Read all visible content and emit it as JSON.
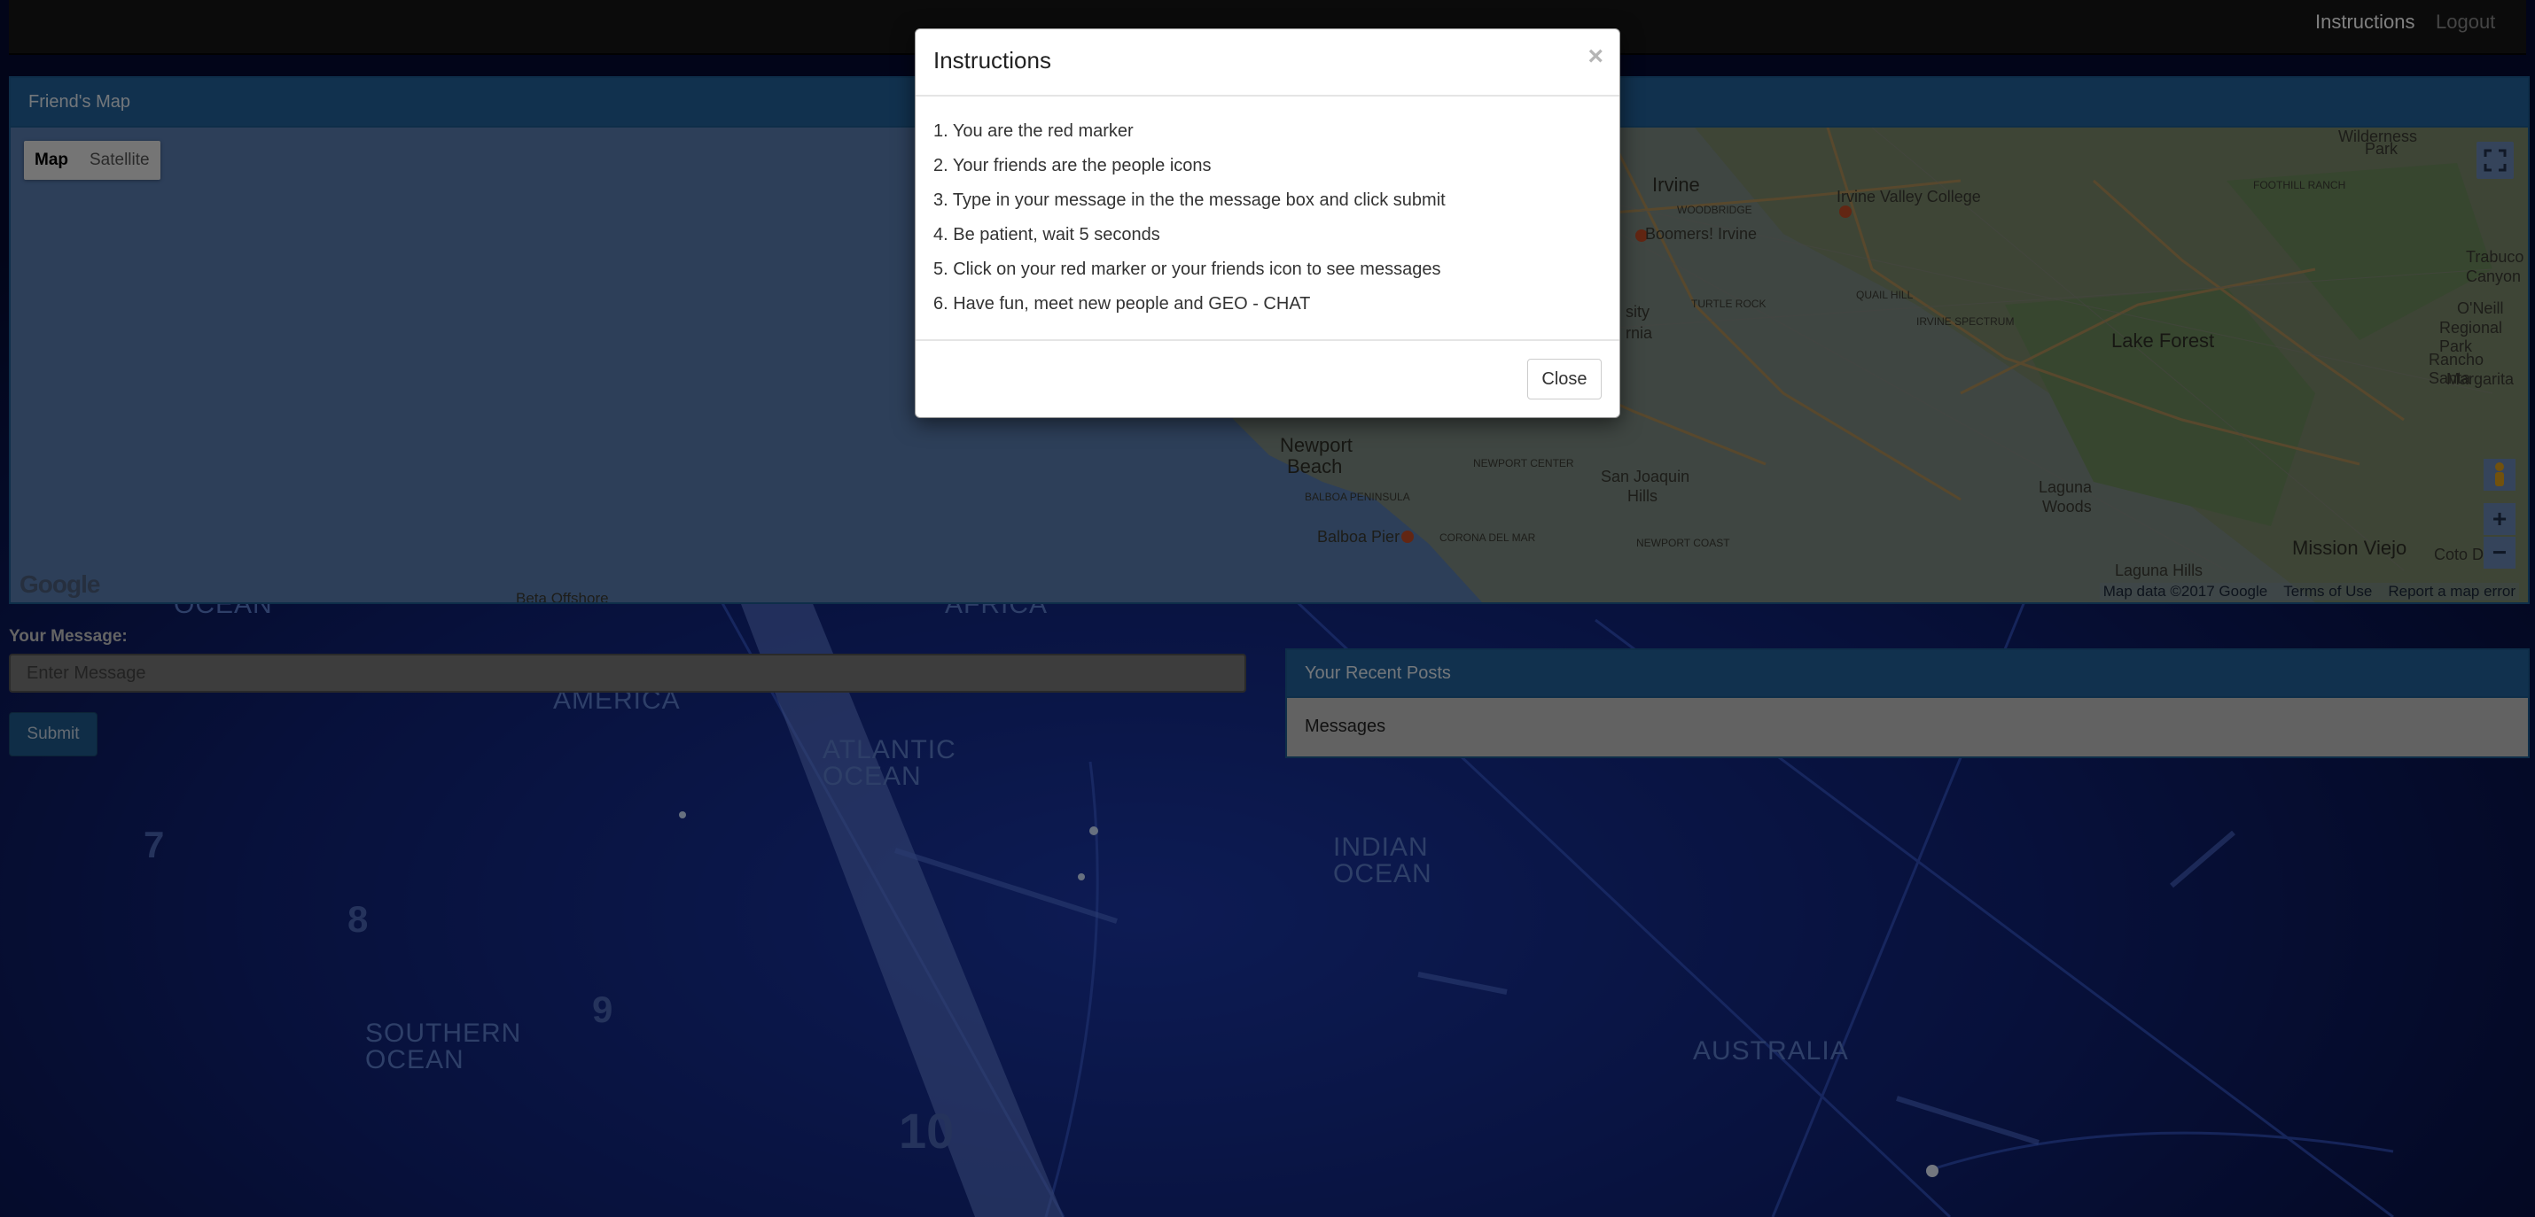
{
  "navbar": {
    "instructions_label": "Instructions",
    "logout_label": "Logout"
  },
  "map_panel": {
    "title": "Friend's Map",
    "map_type_map": "Map",
    "map_type_satellite": "Satellite",
    "zoom_in": "+",
    "zoom_out": "−",
    "google_logo": "Google",
    "attribution": "Map data ©2017 Google",
    "terms": "Terms of Use",
    "report": "Report a map error",
    "places": {
      "irvine": "Irvine",
      "irvine_valley_college": "Irvine Valley College",
      "boomers": "Boomers! Irvine",
      "woodbridge": "WOODBRIDGE",
      "lake_forest": "Lake Forest",
      "newport_beach_1": "Newport",
      "newport_beach_2": "Beach",
      "balboa_pier": "Balboa Pier",
      "san_joaquin_1": "San Joaquin",
      "san_joaquin_2": "Hills",
      "laguna_woods_1": "Laguna",
      "laguna_woods_2": "Woods",
      "mission_viejo": "Mission Viejo",
      "laguna_hills": "Laguna Hills",
      "trabuco_1": "Trabuco",
      "trabuco_2": "Canyon",
      "oneill_1": "O'Neill",
      "oneill_2": "Regional Park",
      "rsm_1": "Rancho Santa",
      "rsm_2": "Margarita",
      "wilderness_1": "Wilderness",
      "wilderness_2": "Park",
      "foothill_ranch": "FOOTHILL RANCH",
      "coto": "Coto D",
      "newport_coast": "NEWPORT COAST",
      "turtle_rock": "TURTLE ROCK",
      "quail_hill": "QUAIL HILL",
      "irvine_spectrum": "IRVINE SPECTRUM",
      "university_1": "sity",
      "university_2": "rnia",
      "corona_del_mar": "CORONA DEL MAR",
      "balboa_peninsula": "BALBOA PENINSULA",
      "newport_center": "NEWPORT CENTER",
      "beta_offshore": "Beta Offshore"
    }
  },
  "message": {
    "label": "Your Message:",
    "placeholder": "Enter Message",
    "submit_label": "Submit"
  },
  "recent_posts": {
    "title": "Your Recent Posts",
    "body": "Messages"
  },
  "background_labels": {
    "ocean": "OCEAN",
    "africa": "AFRICA",
    "america": "AMERICA",
    "atlantic_1": "ATLANTIC",
    "atlantic_2": "OCEAN",
    "indian_1": "INDIAN",
    "indian_2": "OCEAN",
    "southern_1": "SOUTHERN",
    "southern_2": "OCEAN",
    "australia": "AUSTRALIA",
    "num7": "7",
    "num8": "8",
    "num9": "9",
    "num10": "10"
  },
  "modal": {
    "title": "Instructions",
    "close_x": "×",
    "lines": [
      "1. You are the red marker",
      "2. Your friends are the people icons",
      "3. Type in your message in the the message box and click submit",
      "4. Be patient, wait 5 seconds",
      "5. Click on your red marker or your friends icon to see messages",
      "6. Have fun, meet new people and GEO - CHAT"
    ],
    "close_label": "Close"
  },
  "colors": {
    "panel_heading": "#23639c",
    "submit_button": "#1f5a8e",
    "background": "#0a1440",
    "overlay": "rgba(0,0,0,0.5)"
  }
}
